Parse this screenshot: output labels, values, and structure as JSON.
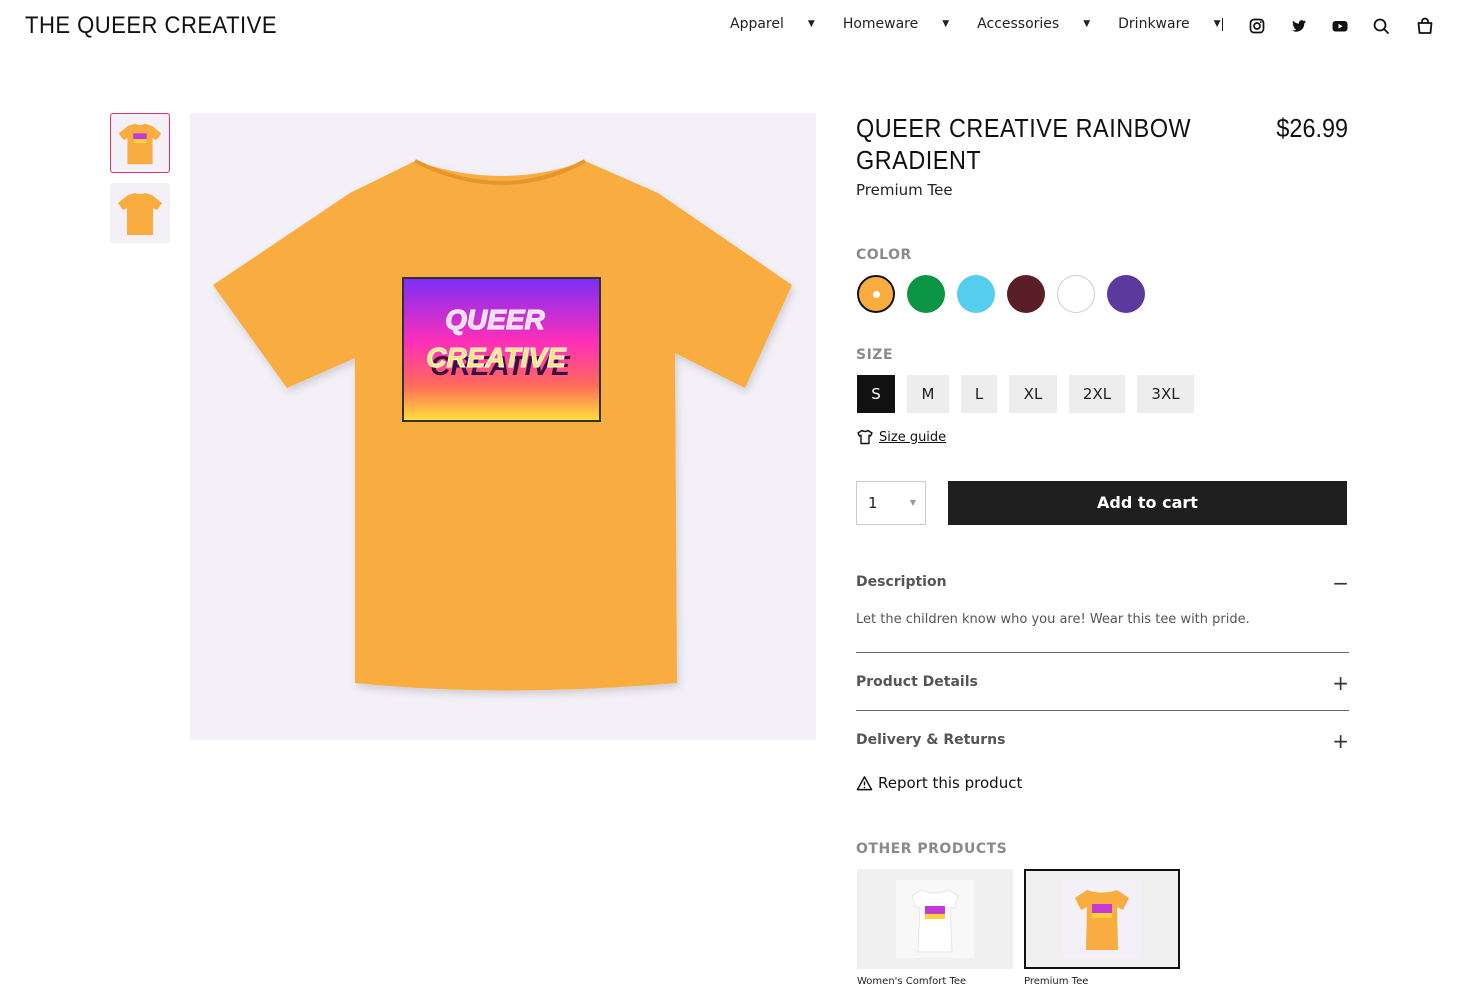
{
  "header": {
    "brand": "THE QUEER CREATIVE",
    "nav": [
      {
        "label": "Apparel"
      },
      {
        "label": "Homeware"
      },
      {
        "label": "Accessories"
      },
      {
        "label": "Drinkware"
      }
    ],
    "separator": "|",
    "icons": [
      "instagram-icon",
      "twitter-icon",
      "youtube-icon",
      "search-icon",
      "cart-bag-icon"
    ]
  },
  "gallery": {
    "thumbnails": [
      {
        "label": "front-view"
      },
      {
        "label": "back-view"
      }
    ],
    "shirt_color": "#f9ad40",
    "print_text": [
      "QUEER",
      "CREATIVE"
    ]
  },
  "product": {
    "title": "QUEER CREATIVE RAINBOW GRADIENT",
    "price": "$26.99",
    "subtitle": "Premium Tee",
    "color_label": "COLOR",
    "colors": [
      {
        "hex": "#f9ad40",
        "selected": true
      },
      {
        "hex": "#0b9444",
        "selected": false
      },
      {
        "hex": "#55cdec",
        "selected": false
      },
      {
        "hex": "#5a1e28",
        "selected": false
      },
      {
        "hex": "#ffffff",
        "selected": false
      },
      {
        "hex": "#5b3a9e",
        "selected": false
      }
    ],
    "size_label": "SIZE",
    "sizes": [
      {
        "label": "S",
        "selected": true
      },
      {
        "label": "M",
        "selected": false
      },
      {
        "label": "L",
        "selected": false
      },
      {
        "label": "XL",
        "selected": false
      },
      {
        "label": "2XL",
        "selected": false
      },
      {
        "label": "3XL",
        "selected": false
      }
    ],
    "size_guide": "Size guide",
    "quantity": "1",
    "add_to_cart": "Add to cart"
  },
  "accordion": {
    "description": {
      "label": "Description",
      "sign": "−",
      "body": "Let the children know who you are! Wear this tee with pride."
    },
    "details": {
      "label": "Product Details",
      "sign": "+"
    },
    "delivery": {
      "label": "Delivery & Returns",
      "sign": "+"
    }
  },
  "report": "Report this product",
  "other_products": {
    "label": "OTHER PRODUCTS",
    "items": [
      {
        "label": "Women's Comfort Tee",
        "shirt_color": "#ffffff",
        "selected": false
      },
      {
        "label": "Premium Tee",
        "shirt_color": "#f9ad40",
        "selected": true
      }
    ]
  },
  "colors": {
    "accent_pink": "#e0306b",
    "button_dark": "#1f1f1f",
    "image_bg": "#f3f1f7"
  }
}
